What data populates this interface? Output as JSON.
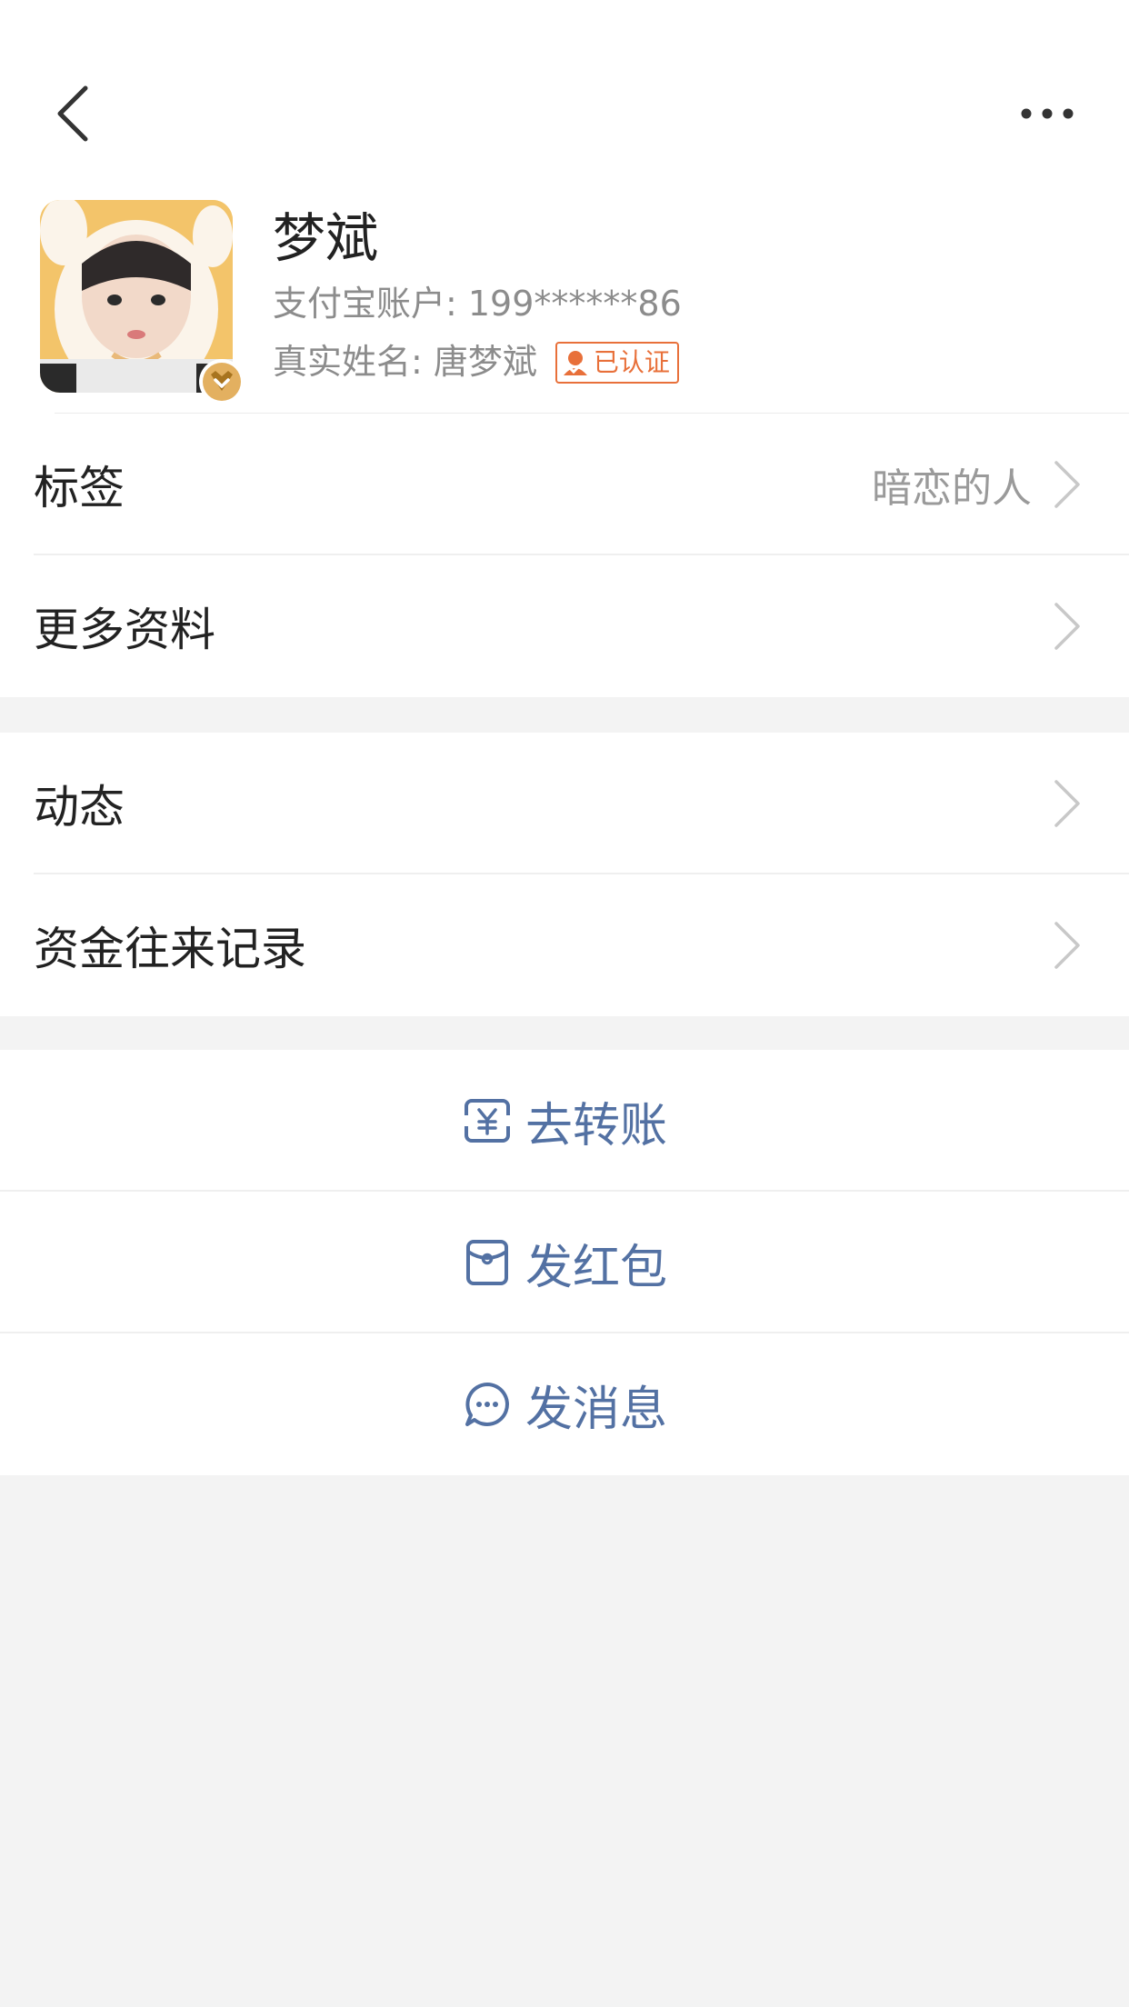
{
  "nav": {
    "back_icon": "chevron-left-icon",
    "more_icon": "more-horizontal-icon"
  },
  "profile": {
    "name": "梦斌",
    "account_label": "支付宝账户: 199******86",
    "realname_label": "真实姓名: 唐梦斌",
    "verified_label": "已认证",
    "avatar_badge_icon": "gold-member-badge-icon",
    "accent_color": "#e8703a"
  },
  "rows": {
    "tag_label": "标签",
    "tag_value": "暗恋的人",
    "more_info_label": "更多资料",
    "moments_label": "动态",
    "fund_records_label": "资金往来记录"
  },
  "actions": {
    "transfer_label": "去转账",
    "transfer_icon": "yuan-transfer-icon",
    "red_packet_label": "发红包",
    "red_packet_icon": "red-envelope-icon",
    "message_label": "发消息",
    "message_icon": "chat-bubble-icon",
    "action_color": "#5371a3"
  }
}
